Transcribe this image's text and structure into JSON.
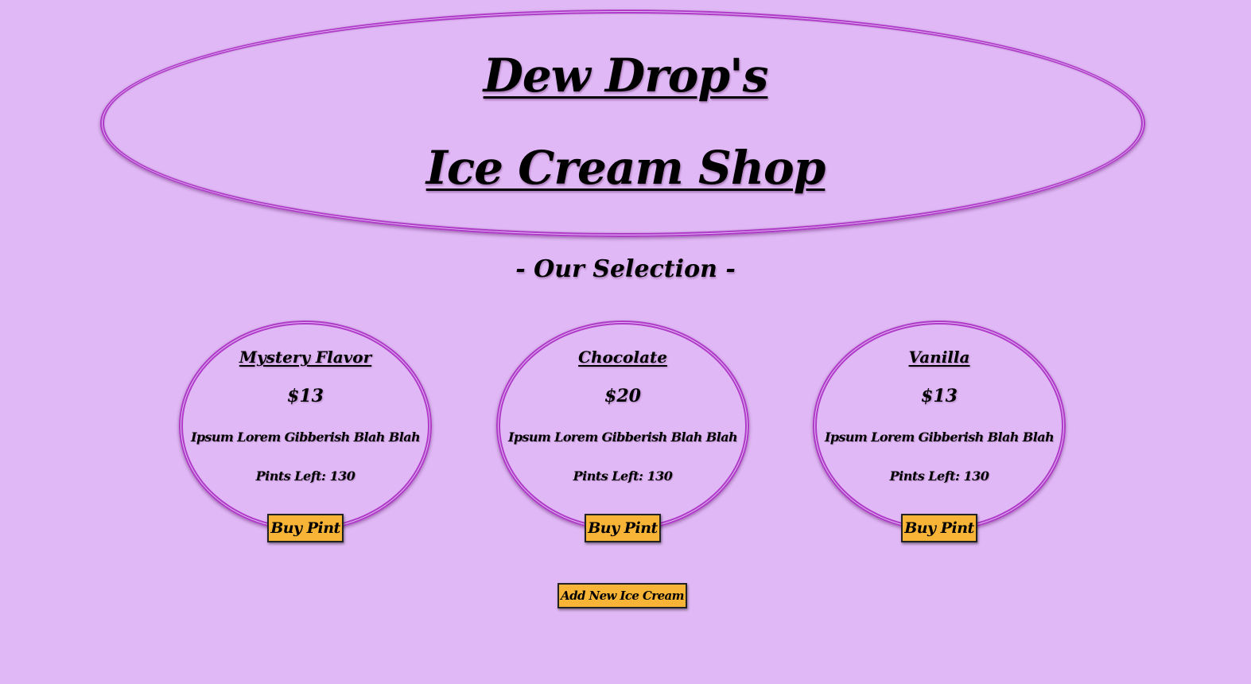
{
  "header": {
    "title_line_1": "Dew Drop's",
    "title_line_2": "Ice Cream Shop"
  },
  "selection": {
    "heading": "- Our Selection -"
  },
  "flavors": [
    {
      "name": "Mystery Flavor",
      "price": "$13",
      "description": "Ipsum Lorem Gibberish Blah Blah",
      "pints_left": "Pints Left: 130",
      "button_label": "Buy Pint"
    },
    {
      "name": "Chocolate",
      "price": "$20",
      "description": "Ipsum Lorem Gibberish Blah Blah",
      "pints_left": "Pints Left: 130",
      "button_label": "Buy Pint"
    },
    {
      "name": "Vanilla",
      "price": "$13",
      "description": "Ipsum Lorem Gibberish Blah Blah",
      "pints_left": "Pints Left: 130",
      "button_label": "Buy Pint"
    }
  ],
  "actions": {
    "add_label": "Add New Ice Cream"
  },
  "colors": {
    "background": "#e0b8f5",
    "accent_border": "#b03ac8",
    "button": "#f7b436"
  }
}
